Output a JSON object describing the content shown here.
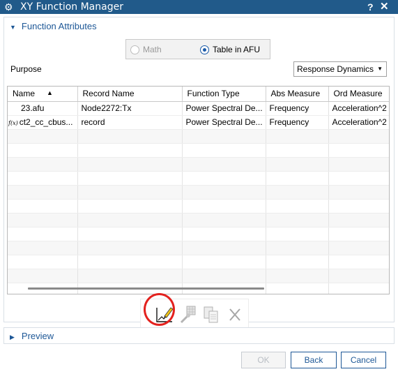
{
  "window": {
    "title": "XY Function Manager",
    "help": "?",
    "close": "✕"
  },
  "function_attributes": {
    "header": "Function Attributes",
    "radio_math": "Math",
    "radio_table": "Table in AFU",
    "selected": "Table in AFU",
    "purpose_label": "Purpose",
    "purpose_value": "Response Dynamics"
  },
  "table": {
    "columns": [
      "Name",
      "Record Name",
      "Function Type",
      "Abs Measure",
      "Ord Measure"
    ],
    "rows": [
      {
        "icon": "",
        "name": "23.afu",
        "record": "Node2272:Tx",
        "type": "Power Spectral De...",
        "abs": "Frequency",
        "ord": "Acceleration^2"
      },
      {
        "icon": "f(x)",
        "name": "ct2_cc_cbus...",
        "record": "record",
        "type": "Power Spectral De...",
        "abs": "Frequency",
        "ord": "Acceleration^2"
      }
    ]
  },
  "toolbar": {
    "icons": [
      "edit-graph-icon",
      "key-grid-icon",
      "copy-icon",
      "delete-icon"
    ]
  },
  "preview": {
    "header": "Preview"
  },
  "buttons": {
    "ok": "OK",
    "back": "Back",
    "cancel": "Cancel"
  },
  "colors": {
    "titlebar": "#215a8a",
    "accent": "#1d5796",
    "highlight": "#e3211e"
  }
}
